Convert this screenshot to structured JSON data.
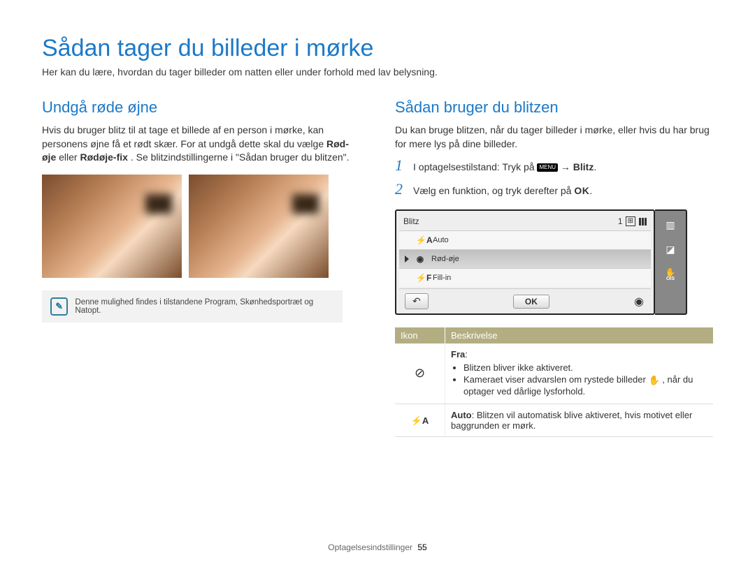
{
  "title": "Sådan tager du billeder i mørke",
  "subtitle": "Her kan du lære, hvordan du tager billeder om natten eller under forhold med lav belysning.",
  "left": {
    "heading": "Undgå røde øjne",
    "para_pre": "Hvis du bruger blitz til at tage et billede af en person i mørke, kan personens øjne få et rødt skær. For at undgå dette skal du vælge ",
    "bold1": "Rød-øje",
    "middle": " eller ",
    "bold2": "Rødøje-fix",
    "post": ". Se blitzindstillingerne i \"Sådan bruger du blitzen\".",
    "note": "Denne mulighed findes i tilstandene Program, Skønhedsportræt og Natopt."
  },
  "right": {
    "heading": "Sådan bruger du blitzen",
    "para": "Du kan bruge blitzen, når du tager billeder i mørke, eller hvis du har brug for mere lys på dine billeder.",
    "step1_pre": "I optagelsestilstand: Tryk på ",
    "step1_arrow": " → ",
    "step1_bold": "Blitz",
    "step1_dot": ".",
    "menu_label": "MENU",
    "step2_pre": "Vælg en funktion, og tryk derefter på ",
    "step2_ok": "OK",
    "step2_dot": "."
  },
  "screen": {
    "title": "Blitz",
    "counter": "1",
    "items": [
      {
        "icon": "⚡A",
        "label": "Auto",
        "selected": false
      },
      {
        "icon": "◉",
        "label": "Rød-øje",
        "selected": true
      },
      {
        "icon": "⚡F",
        "label": "Fill-in",
        "selected": false
      }
    ],
    "ok": "OK",
    "side_ois": "OIS"
  },
  "table": {
    "headers": [
      "Ikon",
      "Beskrivelse"
    ],
    "rows": [
      {
        "icon": "⊘",
        "title": "Fra",
        "bullet1": "Blitzen bliver ikke aktiveret.",
        "bullet2a": "Kameraet viser advarslen om rystede billeder ",
        "bullet2b": ", når du optager ved dårlige lysforhold."
      },
      {
        "icon": "⚡A",
        "title": "Auto",
        "desc": ": Blitzen vil automatisk blive aktiveret, hvis motivet eller baggrunden er mørk."
      }
    ]
  },
  "footer": {
    "section": "Optagelsesindstillinger",
    "page": "55"
  }
}
